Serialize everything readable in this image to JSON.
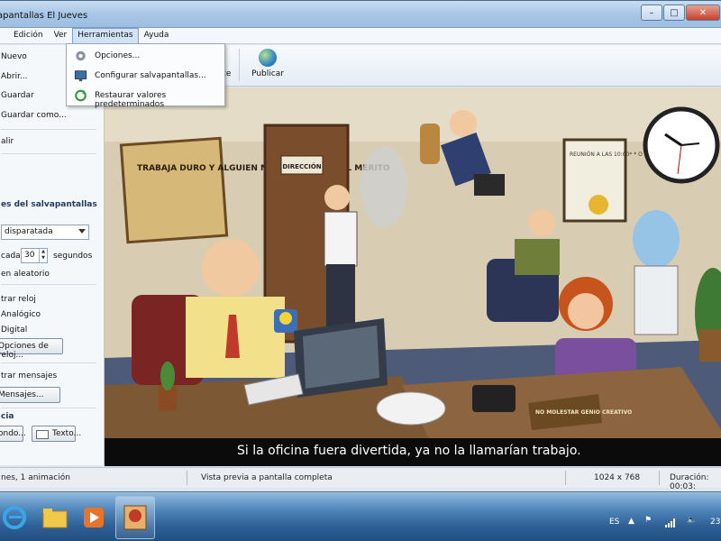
{
  "window": {
    "title": "apantallas El Jueves",
    "buttons": {
      "minimize": "–",
      "maximize": "□",
      "close": "✕"
    }
  },
  "menu": [
    "Edición",
    "Ver",
    "Herramientas",
    "Ayuda"
  ],
  "dropdown": {
    "items": [
      {
        "label": "Opciones...",
        "icon": "gear-icon"
      },
      {
        "label": "Configurar salvapantallas...",
        "icon": "monitor-icon"
      },
      {
        "label": "Restaurar valores predeterminados",
        "icon": "refresh-icon"
      }
    ]
  },
  "sidebar": {
    "file_items": [
      "Nuevo",
      "Abrir...",
      "Guardar",
      "Guardar como...",
      "alir"
    ],
    "section_title": "es del salvapantallas",
    "mode_select": "disparatada",
    "interval_label": "cada:",
    "interval_value": "30",
    "interval_unit": "segundos",
    "random_label": "en aleatorio",
    "clock_label": "trar reloj",
    "analog_label": "Analógico",
    "digital_label": "Digital",
    "clock_options_button": "Opciones de reloj...",
    "messages_label": "trar mensajes",
    "messages_button": "Mensajes...",
    "appearance_title": "cia",
    "background_button": "ondo...",
    "text_button": "Texto..."
  },
  "toolbar": {
    "items": [
      {
        "label": "nte",
        "icon": "next-icon"
      },
      {
        "label": "Publicar",
        "icon": "globe-icon"
      }
    ]
  },
  "preview": {
    "caption": "Si la oficina fuera divertida, ya no la llamarían trabajo.",
    "sign_left": "TRABAJA DURO Y ALGUIEN MÁS SE LLEVARÁ EL MÉRITO",
    "door_sign": "DIRECCIÓN",
    "meeting_sign": "REUNIÓN A LAS 10:00* * O CUANDO LLEGUE EL JEFE",
    "desk_sign": "NO MOLESTAR GENIO CREATIVO"
  },
  "status": {
    "animation": "nes, 1 animación",
    "preview_mode": "Vista previa a pantalla completa",
    "resolution": "1024 x 768",
    "duration": "Duración: 00:03:"
  },
  "taskbar": {
    "language": "ES",
    "time": "23"
  },
  "colors": {
    "accent": "#3a78b0",
    "menu_active": "#d2e3f5"
  }
}
